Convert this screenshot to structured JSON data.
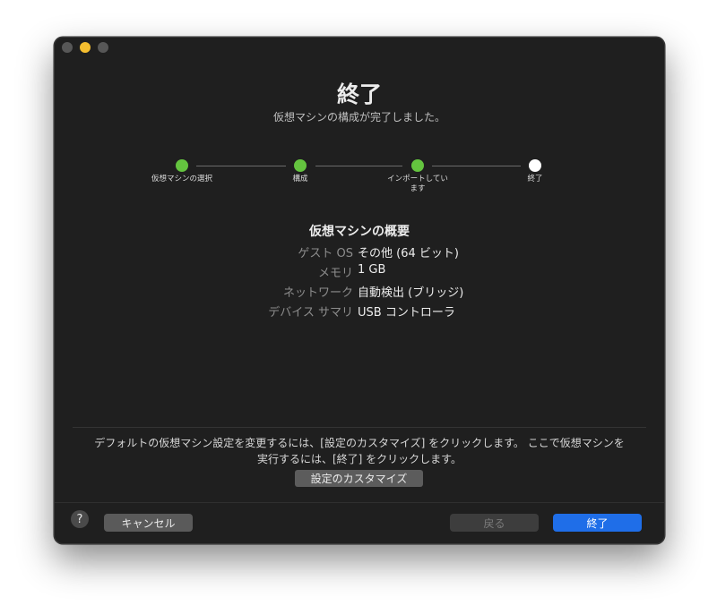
{
  "window": {
    "title": "終了",
    "subtitle": "仮想マシンの構成が完了しました。"
  },
  "steps": [
    {
      "label": "仮想マシンの選択",
      "state": "complete",
      "color": "#64c43f"
    },
    {
      "label": "構成",
      "state": "complete",
      "color": "#64c43f"
    },
    {
      "label": "インポートしてい\nます",
      "state": "complete",
      "color": "#64c43f"
    },
    {
      "label": "終了",
      "state": "current",
      "color": "#ffffff"
    }
  ],
  "summary": {
    "title": "仮想マシンの概要",
    "rows": [
      {
        "key": "ゲスト OS",
        "value": "その他 (64 ビット)"
      },
      {
        "key": "メモリ",
        "value": "1 GB"
      },
      {
        "key": "ネットワーク",
        "value": "自動検出 (ブリッジ)"
      },
      {
        "key": "デバイス サマリ",
        "value": "USB コントローラ"
      }
    ]
  },
  "info_text": "デフォルトの仮想マシン設定を変更するには、[設定のカスタマイズ] をクリックします。 ここで仮想マシンを実行するには、[終了] をクリックします。",
  "buttons": {
    "customize": "設定のカスタマイズ",
    "help": "?",
    "cancel": "キャンセル",
    "back": "戻る",
    "finish": "終了"
  },
  "colors": {
    "accent": "#1f6ee8",
    "step_complete": "#64c43f",
    "background": "#1f1f1f"
  }
}
